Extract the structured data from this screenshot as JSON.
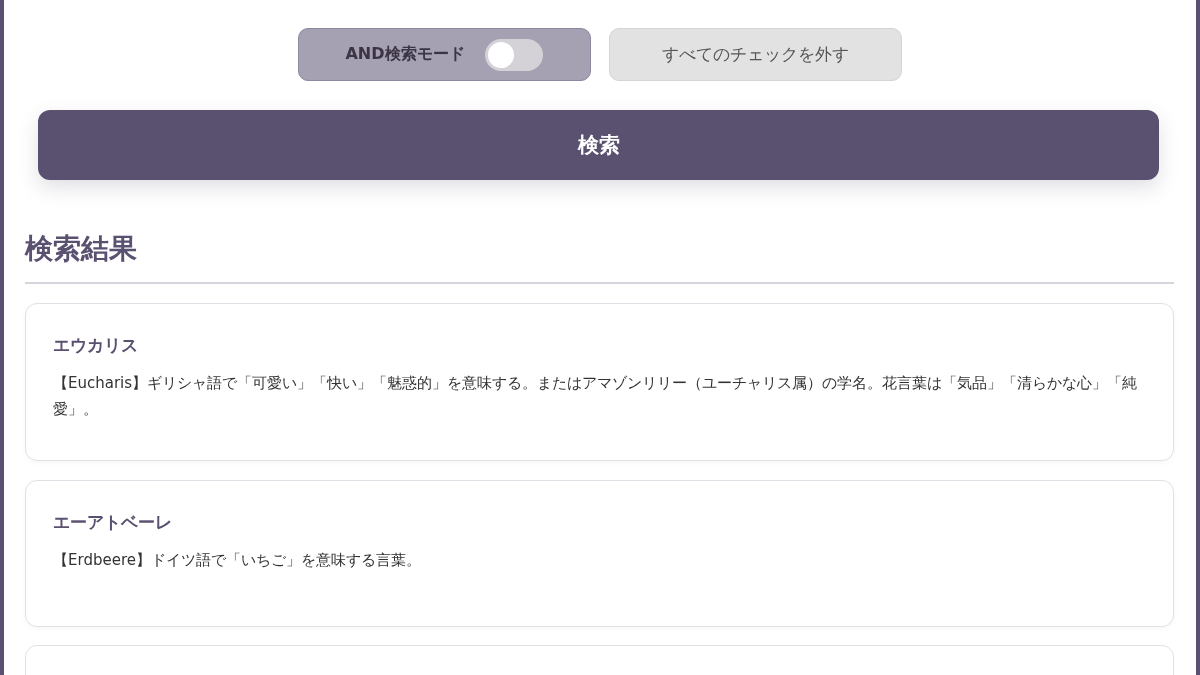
{
  "controls": {
    "and_mode": {
      "label": "AND検索モード",
      "on": false
    },
    "clear_button": "すべてのチェックを外す"
  },
  "search_button": "検索",
  "results": {
    "heading": "検索結果",
    "items": [
      {
        "title": "エウカリス",
        "description": "【Eucharis】ギリシャ語で「可愛い」「快い」「魅惑的」を意味する。またはアマゾンリリー（ユーチャリス属）の学名。花言葉は「気品」「清らかな心」「純愛」。"
      },
      {
        "title": "エーアトベーレ",
        "description": "【Erdbeere】ドイツ語で「いちご」を意味する言葉。"
      }
    ]
  }
}
